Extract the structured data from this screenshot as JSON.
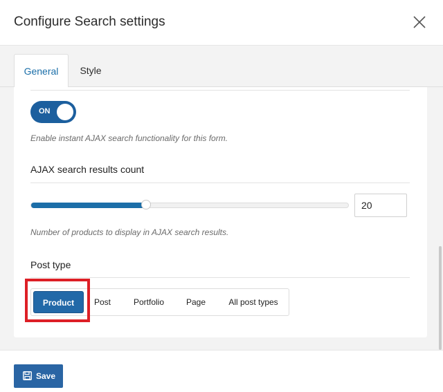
{
  "dialog": {
    "title": "Configure Search settings",
    "close_icon": "close-icon"
  },
  "tabs": [
    {
      "label": "General",
      "active": true
    },
    {
      "label": "Style",
      "active": false
    }
  ],
  "ajax_toggle": {
    "label": "ON",
    "state": true,
    "help": "Enable instant AJAX search functionality for this form."
  },
  "results_count": {
    "label": "AJAX search results count",
    "value": "20",
    "slider_fraction": 0.36,
    "help": "Number of products to display in AJAX search results."
  },
  "post_type": {
    "label": "Post type",
    "options": [
      "Product",
      "Post",
      "Portfolio",
      "Page",
      "All post types"
    ],
    "selected": "Product"
  },
  "footer": {
    "save_label": "Save",
    "save_icon": "floppy-disk-icon"
  },
  "colors": {
    "accent": "#2269a8",
    "highlight": "#dd1f26"
  }
}
